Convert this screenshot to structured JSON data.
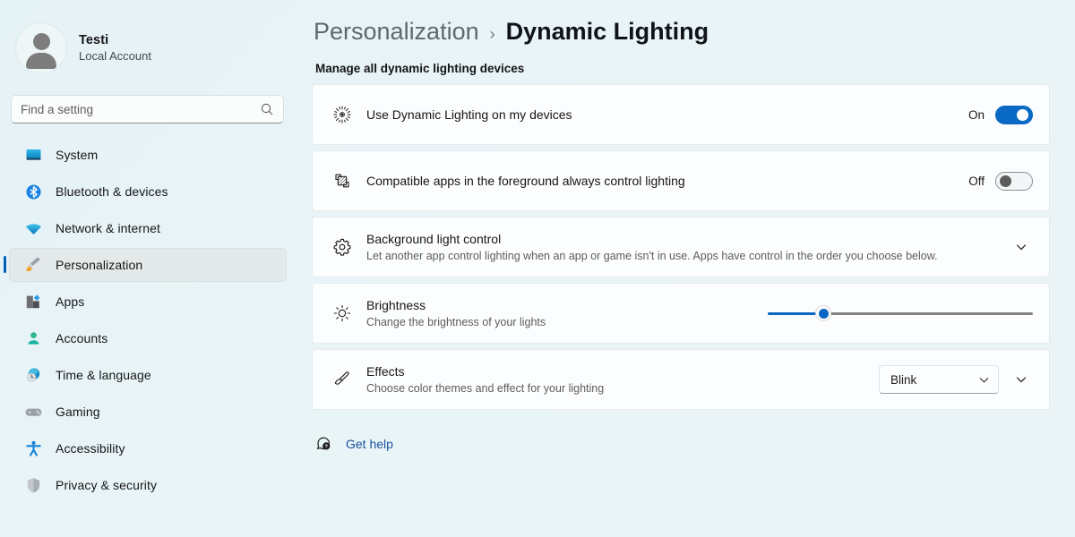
{
  "account": {
    "name": "Testi",
    "subtitle": "Local Account",
    "avatar_icon": "person-avatar-icon"
  },
  "search": {
    "placeholder": "Find a setting",
    "value": "",
    "icon": "search-icon"
  },
  "sidebar": {
    "items": [
      {
        "label": "System",
        "icon": "monitor-icon",
        "selected": false
      },
      {
        "label": "Bluetooth & devices",
        "icon": "bluetooth-icon",
        "selected": false
      },
      {
        "label": "Network & internet",
        "icon": "wifi-icon",
        "selected": false
      },
      {
        "label": "Personalization",
        "icon": "paintbrush-icon",
        "selected": true
      },
      {
        "label": "Apps",
        "icon": "apps-icon",
        "selected": false
      },
      {
        "label": "Accounts",
        "icon": "account-person-icon",
        "selected": false
      },
      {
        "label": "Time & language",
        "icon": "clock-globe-icon",
        "selected": false
      },
      {
        "label": "Gaming",
        "icon": "gamepad-icon",
        "selected": false
      },
      {
        "label": "Accessibility",
        "icon": "accessibility-icon",
        "selected": false
      },
      {
        "label": "Privacy & security",
        "icon": "shield-icon",
        "selected": false
      }
    ]
  },
  "header": {
    "breadcrumb_parent": "Personalization",
    "breadcrumb_separator": "›",
    "breadcrumb_current": "Dynamic Lighting",
    "section_title": "Manage all dynamic lighting devices"
  },
  "settings": {
    "use_dynamic_lighting": {
      "title": "Use Dynamic Lighting on my devices",
      "icon": "brightness-burst-icon",
      "state_label": "On",
      "toggle_state": "on"
    },
    "foreground_control": {
      "title": "Compatible apps in the foreground always control lighting",
      "icon": "overlapping-apps-icon",
      "state_label": "Off",
      "toggle_state": "off"
    },
    "background_light_control": {
      "title": "Background light control",
      "subtitle": "Let another app control lighting when an app or game isn't in use. Apps have control in the order you choose below.",
      "icon": "gear-icon",
      "expander_icon": "chevron-down-icon"
    },
    "brightness": {
      "title": "Brightness",
      "subtitle": "Change the brightness of your lights",
      "icon": "sun-brightness-icon",
      "value": 21,
      "min": 0,
      "max": 100
    },
    "effects": {
      "title": "Effects",
      "subtitle": "Choose color themes and effect for your lighting",
      "icon": "paintbrush-outline-icon",
      "selected_option": "Blink",
      "dropdown_icon": "chevron-down-icon",
      "expander_icon": "chevron-down-icon"
    }
  },
  "footer": {
    "get_help_label": "Get help",
    "get_help_icon": "help-question-icon"
  },
  "colors": {
    "accent": "#0a69c4",
    "page_background": "#e9f4f7",
    "card_background": "#fbfdfe",
    "link": "#18519c",
    "selection_bar": "#005fb8"
  }
}
